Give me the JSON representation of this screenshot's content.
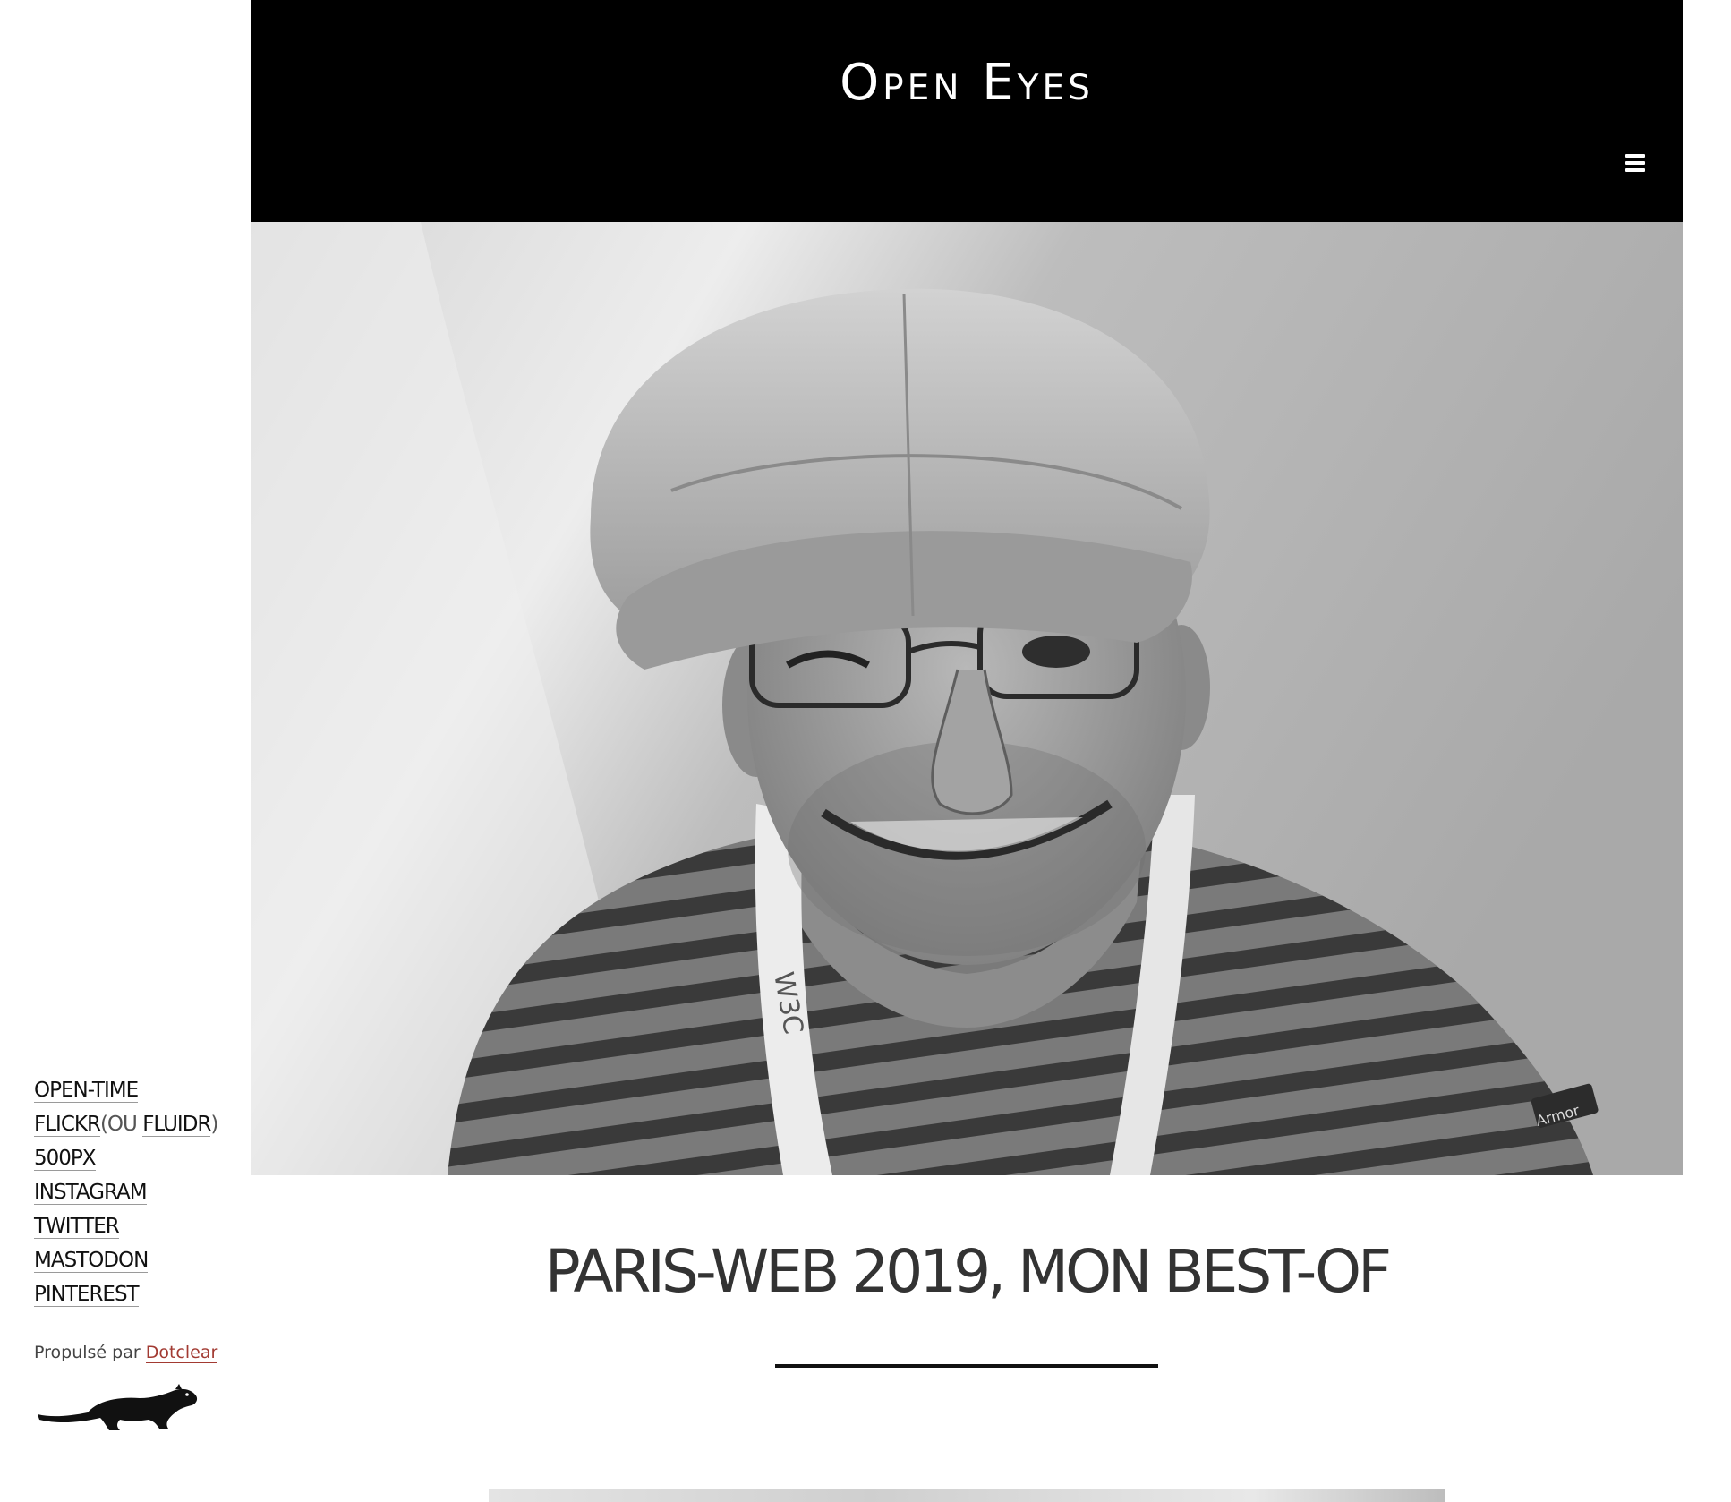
{
  "header": {
    "site_title": "Open Eyes",
    "menu_icon": "hamburger-menu-icon"
  },
  "hero": {
    "image_description": "",
    "lanyard_text": "W3C",
    "shirt_tag_text": "Armor"
  },
  "post": {
    "title": "PARIS-WEB 2019, MON BEST-OF"
  },
  "sidebar": {
    "links": [
      {
        "label": "OPEN-TIME"
      },
      {
        "label": "FLICKR",
        "extra_open": "(OU ",
        "extra_label": "FLUIDR",
        "extra_close": ")"
      },
      {
        "label": "500PX"
      },
      {
        "label": "INSTAGRAM"
      },
      {
        "label": "TWITTER"
      },
      {
        "label": "MASTODON"
      },
      {
        "label": "PINTEREST"
      }
    ],
    "powered_by_prefix": "Propulsé par",
    "powered_by_link": "Dotclear",
    "logo_icon": "dotclear-ferret-icon"
  },
  "colors": {
    "header_bg": "#000000",
    "title_text": "#333333",
    "accent_link": "#a23a32"
  }
}
